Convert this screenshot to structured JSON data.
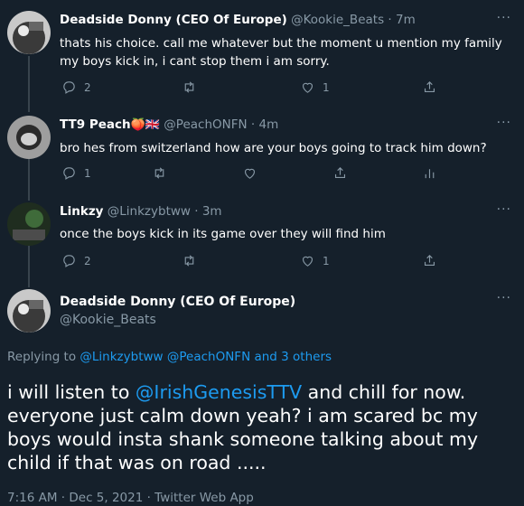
{
  "tweets": [
    {
      "name": "Deadside Donny (CEO Of Europe)",
      "handle": "@Kookie_Beats",
      "sep": "·",
      "time": "7m",
      "more": "···",
      "text": "thats his choice. call me whatever but the moment u mention my family my boys kick in, i cant stop them i am sorry.",
      "replies": "2",
      "likes": "1"
    },
    {
      "name": "TT9 Peach",
      "name_emoji": "🍑🇬🇧",
      "handle": "@PeachONFN",
      "sep": "·",
      "time": "4m",
      "more": "···",
      "text": "bro hes from switzerland how are your boys going to track him down?",
      "replies": "1"
    },
    {
      "name": "Linkzy",
      "handle": "@Linkzybtww",
      "sep": "·",
      "time": "3m",
      "more": "···",
      "text": "once the boys kick in its game over they will find him",
      "replies": "2",
      "likes": "1"
    }
  ],
  "focus": {
    "name": "Deadside Donny (CEO Of Europe)",
    "handle": "@Kookie_Beats",
    "more": "···",
    "replying_prefix": "Replying to ",
    "replying_links": "@Linkzybtww @PeachONFN and 3 others",
    "text_before": "i will listen to ",
    "mention": "@IrishGenesisTTV",
    "text_after": " and chill for now. everyone just calm down yeah? i am scared bc my boys would insta shank someone talking about my child if that was on road .....",
    "footer": "7:16 AM · Dec 5, 2021 · Twitter Web App"
  },
  "colors": {
    "background": "#15202b",
    "link": "#1d9bf0",
    "muted": "#8899a6"
  },
  "icons": [
    "reply-icon",
    "retweet-icon",
    "like-icon",
    "share-icon",
    "analytics-icon"
  ]
}
